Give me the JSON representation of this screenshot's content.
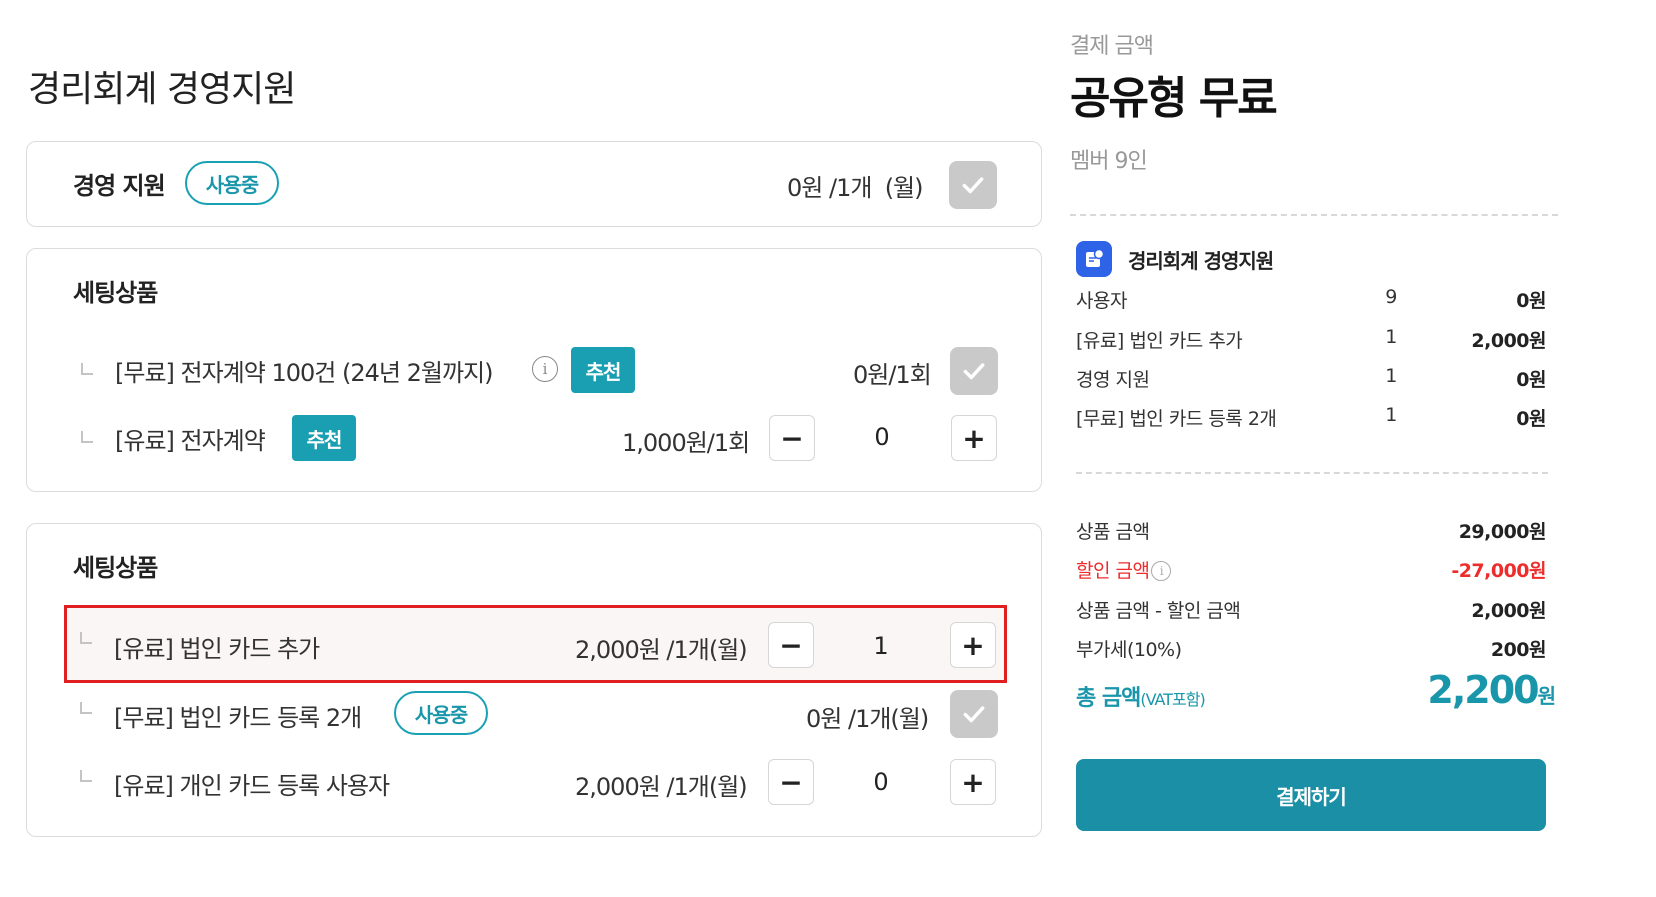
{
  "page_title": "경리회계 경영지원",
  "management": {
    "title": "경영 지원",
    "badge": "사용중",
    "price": "0원 /1개",
    "period": "(월)"
  },
  "section1": {
    "title": "세팅상품",
    "items": [
      {
        "label": "[무료] 전자계약 100건 (24년 2월까지)",
        "tag": "추천",
        "price": "0원/1회"
      },
      {
        "label": "[유료] 전자계약",
        "tag": "추천",
        "price": "1,000원/1회",
        "qty": "0"
      }
    ]
  },
  "section2": {
    "title": "세팅상품",
    "items": [
      {
        "label": "[유료] 법인 카드 추가",
        "price": "2,000원 /1개(월)",
        "qty": "1"
      },
      {
        "label": "[무료] 법인 카드 등록 2개",
        "badge": "사용중",
        "price": "0원 /1개(월)"
      },
      {
        "label": "[유료] 개인 카드 등록 사용자",
        "price": "2,000원 /1개(월)",
        "qty": "0"
      }
    ]
  },
  "summary": {
    "label": "결제 금액",
    "plan": "공유형 무료",
    "members": "멤버 9인",
    "app_name": "경리회계 경영지원",
    "lines": [
      {
        "name": "사용자",
        "count": "9",
        "price": "0원"
      },
      {
        "name": "[유료] 법인 카드 추가",
        "count": "1",
        "price": "2,000원"
      },
      {
        "name": "경영 지원",
        "count": "1",
        "price": "0원"
      },
      {
        "name": "[무료] 법인 카드 등록 2개",
        "count": "1",
        "price": "0원"
      }
    ],
    "totals": {
      "product_label": "상품 금액",
      "product_value": "29,000원",
      "discount_label": "할인 금액",
      "discount_value": "-27,000원",
      "net_label": "상품 금액 - 할인 금액",
      "net_value": "2,000원",
      "vat_label": "부가세(10%)",
      "vat_value": "200원"
    },
    "grand_label": "총 금액",
    "grand_note": "(VAT포함)",
    "grand_value": "2,200",
    "grand_unit": "원",
    "pay_button": "결제하기"
  },
  "icons": {
    "check": "check-icon",
    "info": "info-icon",
    "minus": "minus-icon",
    "plus": "plus-icon",
    "app": "app-icon"
  },
  "colors": {
    "accent": "#1a96aa",
    "discount": "#ee2c2c",
    "highlight_border": "#e02020",
    "app_icon": "#2e63e8"
  }
}
